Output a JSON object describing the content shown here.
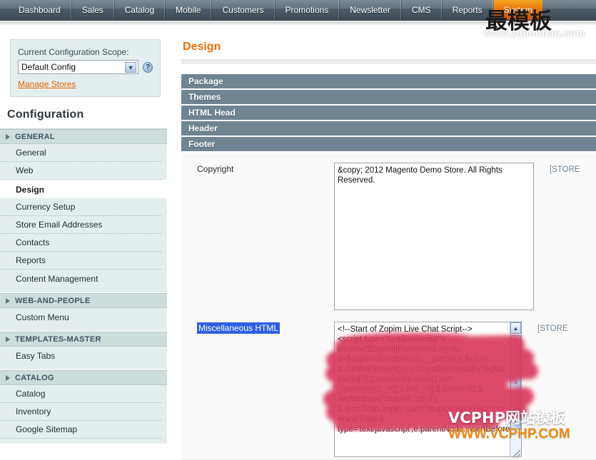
{
  "topnav": {
    "items": [
      {
        "label": "Dashboard"
      },
      {
        "label": "Sales"
      },
      {
        "label": "Catalog"
      },
      {
        "label": "Mobile"
      },
      {
        "label": "Customers"
      },
      {
        "label": "Promotions"
      },
      {
        "label": "Newsletter"
      },
      {
        "label": "CMS"
      },
      {
        "label": "Reports"
      },
      {
        "label": "System"
      }
    ]
  },
  "scope": {
    "label": "Current Configuration Scope:",
    "selected": "Default Config",
    "arrow_icon": "chevron-down-icon",
    "help_icon": "help-icon",
    "help_glyph": "?",
    "manage_stores_link": "Manage Stores"
  },
  "sidebar": {
    "title": "Configuration",
    "sections": [
      {
        "title": "GENERAL",
        "items": [
          {
            "label": "General",
            "active": false
          },
          {
            "label": "Web",
            "active": false
          },
          {
            "label": "Design",
            "active": true
          },
          {
            "label": "Currency Setup",
            "active": false
          },
          {
            "label": "Store Email Addresses",
            "active": false
          },
          {
            "label": "Contacts",
            "active": false
          },
          {
            "label": "Reports",
            "active": false
          },
          {
            "label": "Content Management",
            "active": false
          }
        ]
      },
      {
        "title": "WEB-AND-PEOPLE",
        "items": [
          {
            "label": "Custom Menu",
            "active": false
          }
        ]
      },
      {
        "title": "TEMPLATES-MASTER",
        "items": [
          {
            "label": "Easy Tabs",
            "active": false
          }
        ]
      },
      {
        "title": "CATALOG",
        "items": [
          {
            "label": "Catalog",
            "active": false
          },
          {
            "label": "Inventory",
            "active": false
          },
          {
            "label": "Google Sitemap",
            "active": false
          }
        ]
      }
    ]
  },
  "main": {
    "page_title": "Design",
    "sections": [
      {
        "label": "Package"
      },
      {
        "label": "Themes"
      },
      {
        "label": "HTML Head"
      },
      {
        "label": "Header"
      },
      {
        "label": "Footer"
      }
    ],
    "fields": [
      {
        "label": "Copyright",
        "selected": false,
        "value": "&copy; 2012 Magento Demo Store. All Rights Reserved.",
        "scope": "[STORE"
      },
      {
        "label": "Miscellaneous HTML",
        "selected": true,
        "value": "<!--Start of Zopim Live Chat Script-->\n<script type=\"text/javascript\">\nwindow.$zopim||(function(d,s){var\nz=$zopim=function(c){z._.push(c)},$=z.s=\nd.createElement(s),e=d.getElementsByTagNa\nme(s)[0];z.set=function(o){z.set.\n_.push(o)};z._=[];z.set._=[];$.async=!0;$.\nsetAttribute('charset','utf-8');\n$.src='//cdn.zopim.com/?XnpOOBgjXH4c';z.t=\n+new Date;$.\ntype='text/javascript';e.parentNode.insertBefore",
        "scope": "[STORE"
      }
    ]
  },
  "watermarks": {
    "top_cn": "最模板",
    "top_url": "www.zuimoban.com",
    "bottom_cn": "VCPHP网站模板",
    "bottom_url": "WWW.VCPHP.COM"
  },
  "colors": {
    "accent_orange": "#e8700d",
    "section_header": "#6f8591",
    "nav_dark": "#4e5c67",
    "sidebar_bg": "#e5eeee",
    "link_orange": "#e06303",
    "selection_blue": "#2f5fe0",
    "redaction_red": "#d93a5e"
  }
}
